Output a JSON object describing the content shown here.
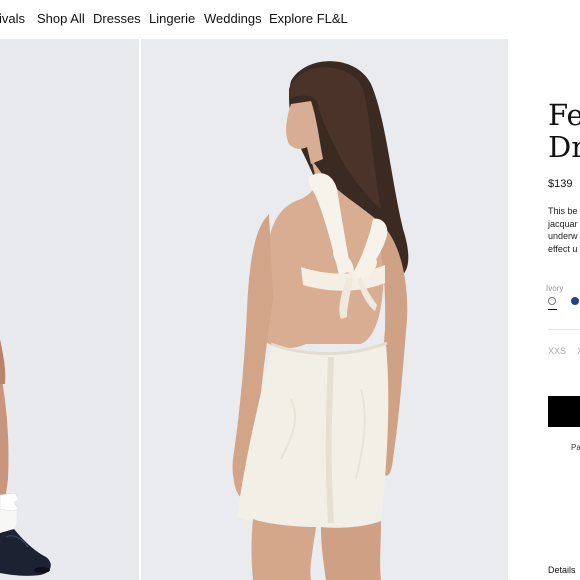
{
  "nav": {
    "items": [
      "ivals",
      "Shop All",
      "Dresses",
      "Lingerie",
      "Weddings",
      "Explore FL&L"
    ]
  },
  "gallery": {
    "images": [
      {
        "subject": "Model legs wearing white frilly socks and navy mary jane shoes"
      },
      {
        "subject": "Model shown from the back in an ivory open-back mini dress with a bow tie"
      }
    ]
  },
  "product": {
    "title_line1": "Fe",
    "title_line2": "Dr",
    "price": "$139",
    "description": [
      "This be",
      "jacquar",
      "underw",
      "effect u"
    ],
    "color_label": "Ivory",
    "colors": [
      {
        "name": "ivory",
        "hex": "#ffffff"
      },
      {
        "name": "navy",
        "hex": "#22418f"
      }
    ],
    "sizes": [
      "XXS",
      "X"
    ],
    "pay_note": "Pa",
    "details_label": "Details"
  }
}
